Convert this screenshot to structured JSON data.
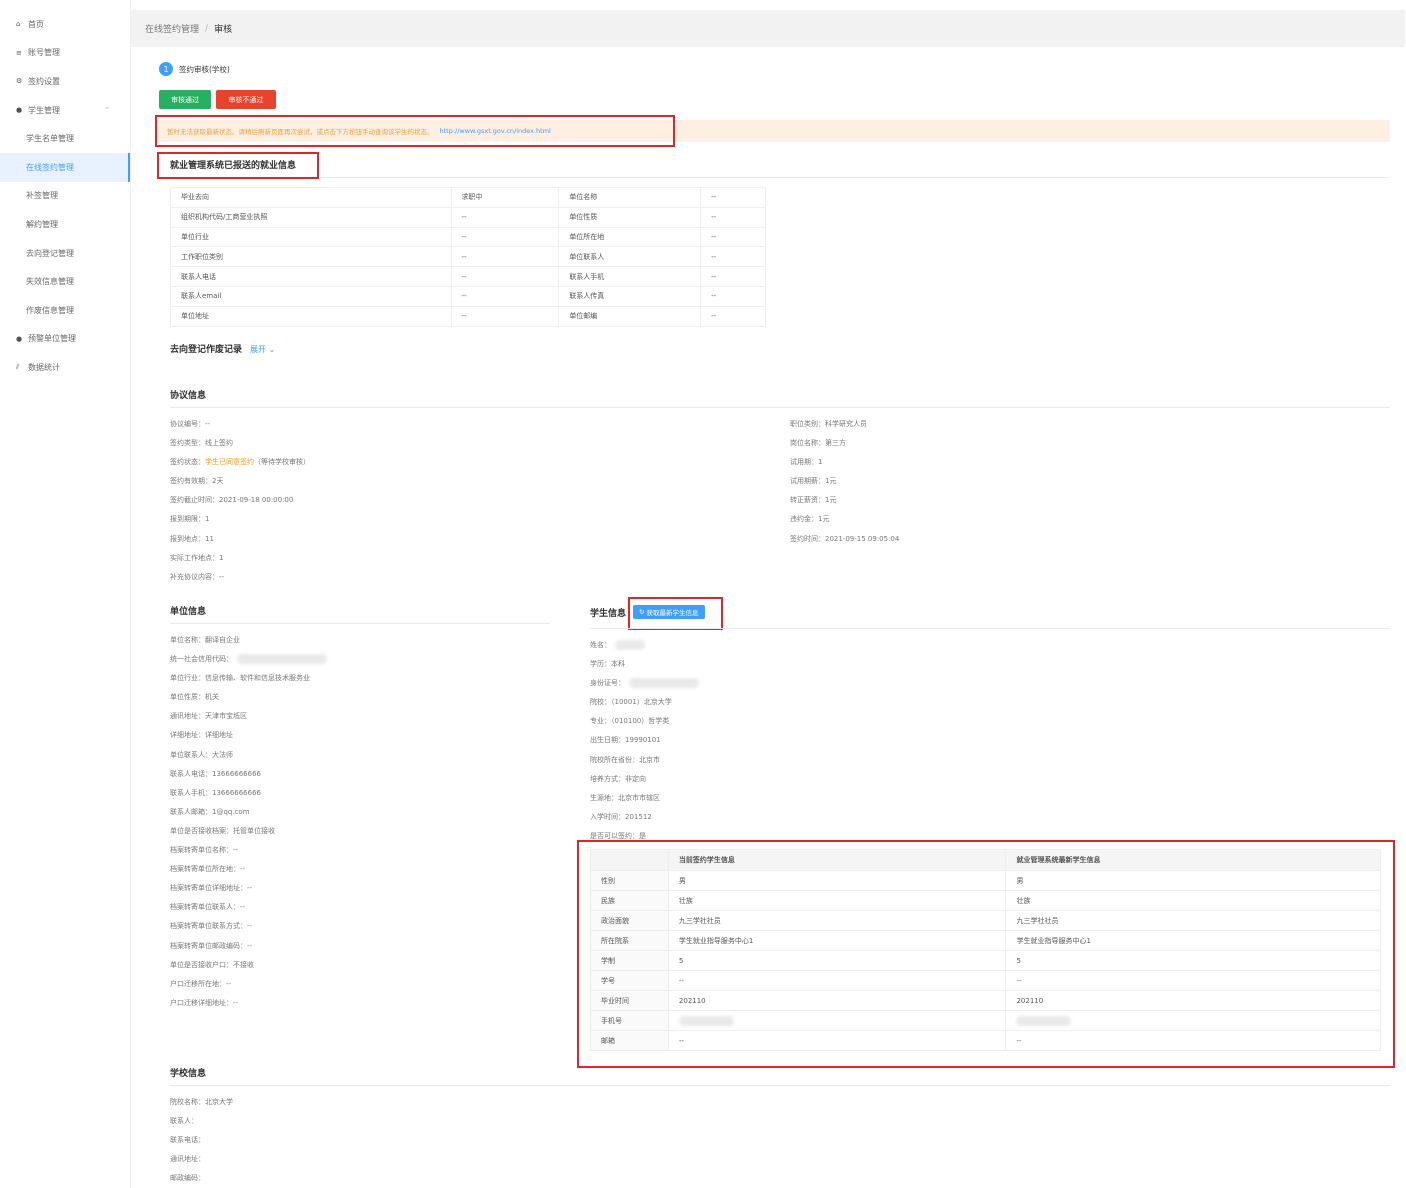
{
  "sidebar": {
    "items": [
      {
        "icon": "home-icon",
        "glyph": "⌂",
        "label": "首页"
      },
      {
        "icon": "list-icon",
        "glyph": "≡",
        "label": "账号管理"
      },
      {
        "icon": "settings-icon",
        "glyph": "⚙",
        "label": "签约设置"
      },
      {
        "icon": "student-icon",
        "glyph": "●",
        "label": "学生管理"
      },
      {
        "label": "学生名单管理"
      },
      {
        "label": "在线签约管理"
      },
      {
        "label": "补签管理"
      },
      {
        "label": "解约管理"
      },
      {
        "label": "去向登记管理"
      },
      {
        "label": "失效信息管理"
      },
      {
        "label": "作废信息管理"
      },
      {
        "icon": "company-icon",
        "glyph": "●",
        "label": "预警单位管理"
      },
      {
        "icon": "stats-icon",
        "glyph": "⫽",
        "label": "数据统计"
      }
    ]
  },
  "breadcrumb": {
    "parent": "在线签约管理",
    "separator": "/",
    "current": "审核"
  },
  "step": {
    "number": "1",
    "label": "签约审核(学校)"
  },
  "actions": {
    "approve": "审核通过",
    "reject": "审核不通过"
  },
  "warning": {
    "text": "暂时无法获取最新状态。请稍后刷新页面再次尝试，或点击下方按钮手动查询该学生的状态。",
    "link": "http://www.gsxt.gov.cn/index.html"
  },
  "employment": {
    "title": "就业管理系统已报送的就业信息",
    "rows": [
      [
        "毕业去向",
        "求职中",
        "单位名称",
        "--"
      ],
      [
        "组织机构代码/工商营业执照",
        "--",
        "单位性质",
        "--"
      ],
      [
        "单位行业",
        "--",
        "单位所在地",
        "--"
      ],
      [
        "工作职位类别",
        "--",
        "单位联系人",
        "--"
      ],
      [
        "联系人电话",
        "--",
        "联系人手机",
        "--"
      ],
      [
        "联系人email",
        "--",
        "联系人传真",
        "--"
      ],
      [
        "单位地址",
        "--",
        "单位邮编",
        "--"
      ]
    ]
  },
  "record": {
    "title": "去向登记作废记录",
    "expand": "展开"
  },
  "agreement": {
    "title": "协议信息",
    "left": [
      {
        "k": "协议编号：",
        "v": "--"
      },
      {
        "k": "签约类型：",
        "v": "线上签约"
      },
      {
        "k": "签约状态：",
        "v": "学生已同意签约",
        "extra": "（等待学校审核）"
      },
      {
        "k": "签约有效期：",
        "v": "2天"
      },
      {
        "k": "签约截止时间：",
        "v": "2021-09-18 00:00:00"
      },
      {
        "k": "报到期限：",
        "v": "1"
      },
      {
        "k": "报到地点：",
        "v": "11"
      },
      {
        "k": "实际工作地点：",
        "v": "1"
      },
      {
        "k": "补充协议内容：",
        "v": "--"
      }
    ],
    "right": [
      {
        "k": "职位类别：",
        "v": "科学研究人员"
      },
      {
        "k": "岗位名称：",
        "v": "第三方"
      },
      {
        "k": "试用期：",
        "v": "1"
      },
      {
        "k": "试用期薪：",
        "v": "1元"
      },
      {
        "k": "转正薪资：",
        "v": "1元"
      },
      {
        "k": "违约金：",
        "v": "1元"
      },
      {
        "k": "签约时间：",
        "v": "2021-09-15 09:05:04"
      }
    ]
  },
  "company": {
    "title": "单位信息",
    "items": [
      {
        "k": "单位名称：",
        "v": "翻译自企业"
      },
      {
        "k": "统一社会信用代码：",
        "v": ""
      },
      {
        "k": "单位行业：",
        "v": "信息传输、软件和信息技术服务业"
      },
      {
        "k": "单位性质：",
        "v": "机关"
      },
      {
        "k": "通讯地址：",
        "v": "天津市宝坻区"
      },
      {
        "k": "详细地址：",
        "v": "详细地址"
      },
      {
        "k": "单位联系人：",
        "v": "大法师"
      },
      {
        "k": "联系人电话：",
        "v": "13666666666"
      },
      {
        "k": "联系人手机：",
        "v": "13666666666"
      },
      {
        "k": "联系人邮箱：",
        "v": "1@qq.com"
      },
      {
        "k": "单位是否接收档案：",
        "v": "托管单位接收"
      },
      {
        "k": "档案转寄单位名称：",
        "v": "--"
      },
      {
        "k": "档案转寄单位所在地：",
        "v": "--"
      },
      {
        "k": "档案转寄单位详细地址：",
        "v": "--"
      },
      {
        "k": "档案转寄单位联系人：",
        "v": "--"
      },
      {
        "k": "档案转寄单位联系方式：",
        "v": "--"
      },
      {
        "k": "档案转寄单位邮政编码：",
        "v": "--"
      },
      {
        "k": "单位是否接收户口：",
        "v": "不接收"
      },
      {
        "k": "户口迁移所在地：",
        "v": "--"
      },
      {
        "k": "户口迁移详细地址：",
        "v": "--"
      }
    ]
  },
  "student": {
    "title": "学生信息",
    "refresh": "获取最新学生信息",
    "items": [
      {
        "k": "姓名：",
        "v": ""
      },
      {
        "k": "学历：",
        "v": "本科"
      },
      {
        "k": "身份证号：",
        "v": ""
      },
      {
        "k": "院校：",
        "v": "（10001）北京大学"
      },
      {
        "k": "专业：",
        "v": "（010100）哲学类"
      },
      {
        "k": "出生日期：",
        "v": "19990101"
      },
      {
        "k": "院校所在省份：",
        "v": "北京市"
      },
      {
        "k": "培养方式：",
        "v": "非定向"
      },
      {
        "k": "生源地：",
        "v": "北京市市辖区"
      },
      {
        "k": "入学时间：",
        "v": "201512"
      },
      {
        "k": "是否可以签约：",
        "v": "是"
      }
    ]
  },
  "compare": {
    "headers": [
      "",
      "当前签约学生信息",
      "就业管理系统最新学生信息"
    ],
    "rows": [
      [
        "性别",
        "男",
        "男"
      ],
      [
        "民族",
        "壮族",
        "壮族"
      ],
      [
        "政治面貌",
        "九三学社社员",
        "九三学社社员"
      ],
      [
        "所在院系",
        "学生就业指导服务中心1",
        "学生就业指导服务中心1"
      ],
      [
        "学制",
        "5",
        "5"
      ],
      [
        "学号",
        "--",
        "--"
      ],
      [
        "毕业时间",
        "202110",
        "202110"
      ],
      [
        "手机号",
        "",
        ""
      ],
      [
        "邮箱",
        "--",
        "--"
      ]
    ]
  },
  "school": {
    "title": "学校信息",
    "items": [
      {
        "k": "院校名称：",
        "v": "北京大学"
      },
      {
        "k": "联系人：",
        "v": ""
      },
      {
        "k": "联系电话：",
        "v": ""
      },
      {
        "k": "通讯地址：",
        "v": ""
      },
      {
        "k": "邮政编码：",
        "v": ""
      }
    ]
  },
  "colors": {
    "primary": "#409eff",
    "approve": "#28b062",
    "reject": "#e8432d",
    "highlight": "#e0262b",
    "warning_bg": "#fdf0e2"
  }
}
